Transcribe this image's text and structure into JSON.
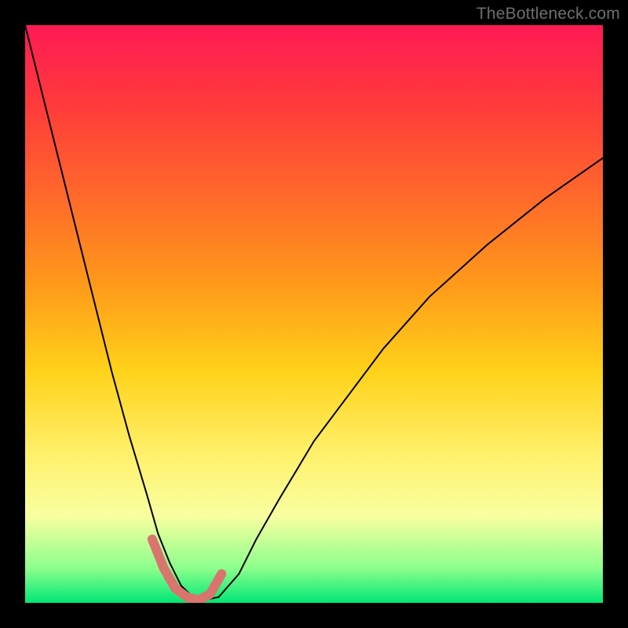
{
  "watermark": "TheBottleneck.com",
  "chart_data": {
    "type": "line",
    "title": "",
    "xlabel": "",
    "ylabel": "",
    "xlim": [
      0,
      100
    ],
    "ylim": [
      0,
      100
    ],
    "grid": false,
    "legend": false,
    "background_gradient": {
      "top": "#ff1a55",
      "mid_upper": "#ff9a1a",
      "mid_lower": "#fff06a",
      "bottom": "#00e676"
    },
    "series": [
      {
        "name": "bottleneck-curve",
        "color": "#000000",
        "stroke_width": 2,
        "x": [
          0,
          3,
          6,
          9,
          12,
          15,
          18,
          21,
          23,
          25,
          27,
          29,
          31,
          33.5,
          37,
          40,
          44,
          50,
          56,
          62,
          70,
          80,
          90,
          100
        ],
        "y": [
          100,
          88,
          76,
          64,
          52,
          40,
          29,
          19,
          12,
          7,
          3,
          1,
          0.5,
          1,
          5,
          11,
          18,
          28,
          36,
          44,
          53,
          62,
          70,
          77
        ]
      },
      {
        "name": "highlight-segment",
        "color": "#d9746e",
        "stroke_width": 12,
        "x": [
          22,
          24,
          26,
          28,
          30,
          32,
          34
        ],
        "y": [
          11,
          6,
          2.5,
          1,
          0.5,
          1.5,
          5
        ]
      }
    ]
  }
}
